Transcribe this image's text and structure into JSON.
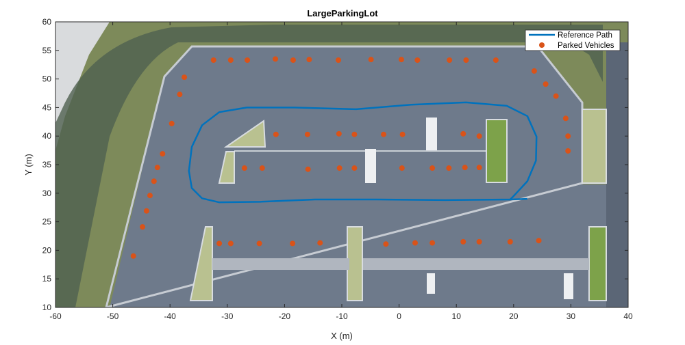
{
  "chart_data": {
    "type": "scatter",
    "title": "LargeParkingLot",
    "xlabel": "X (m)",
    "ylabel": "Y (m)",
    "xlim": [
      -60,
      40
    ],
    "ylim": [
      10,
      60
    ],
    "xticks": [
      -60,
      -50,
      -40,
      -30,
      -20,
      -10,
      0,
      10,
      20,
      30,
      40
    ],
    "yticks": [
      10,
      15,
      20,
      25,
      30,
      35,
      40,
      45,
      50,
      55,
      60
    ],
    "grid": false,
    "background": "aerial image of parking lot",
    "legend": {
      "placement": "top-right",
      "entries": [
        "Reference Path",
        "Parked Vehicles"
      ]
    },
    "series": [
      {
        "name": "Reference Path",
        "type": "line",
        "color": "#0072BD",
        "x": [
          22.4,
          19.4,
          8.1,
          -3.9,
          -14.7,
          -24.2,
          -31.4,
          -34.4,
          -36.2,
          -36.7,
          -36.2,
          -34.4,
          -31.4,
          -26.6,
          -18.3,
          -7.5,
          2.1,
          11.7,
          18.8,
          22.4,
          24.0,
          23.9,
          22.4,
          20.0,
          19.4
        ],
        "y": [
          29.0,
          28.9,
          28.8,
          28.9,
          28.9,
          28.5,
          28.4,
          29.1,
          30.9,
          33.9,
          38.1,
          41.9,
          44.2,
          45.0,
          45.0,
          44.7,
          45.5,
          45.9,
          45.3,
          43.5,
          39.9,
          35.7,
          32.1,
          29.5,
          28.9
        ]
      },
      {
        "name": "Parked Vehicles",
        "type": "scatter",
        "color": "#D95319",
        "x": [
          -32.4,
          -29.4,
          -26.5,
          -21.6,
          -18.5,
          -15.7,
          -10.6,
          -4.9,
          0.4,
          3.2,
          8.8,
          11.7,
          16.9,
          -37.5,
          -38.3,
          -39.7,
          -41.3,
          -42.2,
          -42.8,
          -43.5,
          -44.1,
          -44.8,
          -46.4,
          -21.5,
          -16.0,
          -10.5,
          -7.8,
          -2.7,
          0.6,
          11.2,
          14.0,
          -27.0,
          -23.9,
          -15.9,
          -10.4,
          -7.8,
          0.5,
          5.8,
          8.7,
          11.5,
          14.0,
          23.6,
          25.6,
          27.4,
          29.1,
          29.5,
          29.5,
          -31.4,
          -29.4,
          -24.4,
          -18.6,
          -13.8,
          -2.3,
          2.8,
          5.8,
          11.2,
          14.0,
          19.4,
          24.4
        ],
        "y": [
          53.3,
          53.3,
          53.3,
          53.5,
          53.3,
          53.4,
          53.3,
          53.4,
          53.4,
          53.3,
          53.3,
          53.3,
          53.3,
          50.3,
          47.3,
          42.2,
          36.9,
          34.5,
          32.1,
          29.6,
          26.9,
          24.1,
          19.0,
          40.3,
          40.3,
          40.4,
          40.3,
          40.3,
          40.3,
          40.4,
          40.0,
          34.4,
          34.4,
          34.2,
          34.4,
          34.4,
          34.4,
          34.4,
          34.4,
          34.5,
          34.5,
          51.4,
          49.1,
          47.0,
          43.1,
          40.0,
          37.4,
          21.2,
          21.2,
          21.2,
          21.2,
          21.3,
          21.1,
          21.3,
          21.3,
          21.5,
          21.5,
          21.5,
          21.7
        ]
      }
    ]
  }
}
